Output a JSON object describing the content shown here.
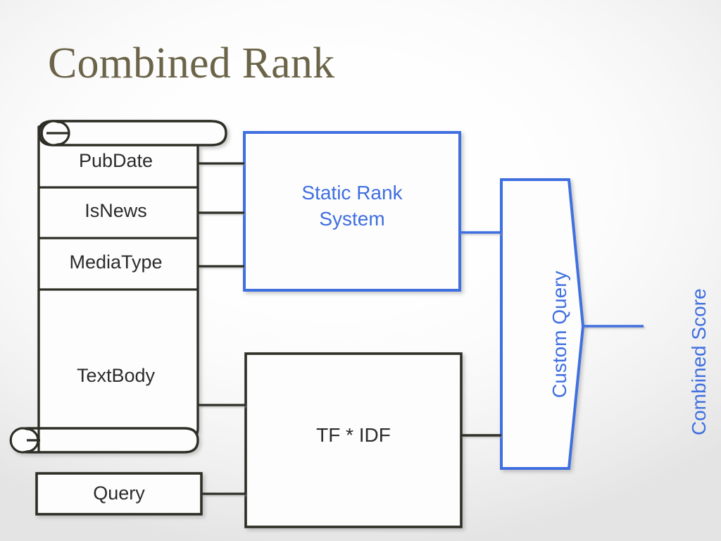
{
  "slide": {
    "title": "Combined Rank",
    "title_color": "#6b6449",
    "background": "#f2f2f2",
    "accent_blue": "#3f6fe0",
    "dark_stroke": "#2e2e27"
  },
  "document_scroll": {
    "name": "document-scroll",
    "rows": [
      {
        "label": "PubDate"
      },
      {
        "label": "IsNews"
      },
      {
        "label": "MediaType"
      },
      {
        "label": "TextBody"
      }
    ]
  },
  "query_box": {
    "label": "Query",
    "border_color": "#2e2e27",
    "text_color": "#2b2b2b"
  },
  "static_rank_box": {
    "label": "Static Rank\nSystem",
    "line1": "Static Rank",
    "line2": "System",
    "border_color": "#3f6fe0",
    "text_color": "#3f6fe0"
  },
  "tfidf_box": {
    "label": "TF * IDF",
    "border_color": "#2e2e27",
    "text_color": "#2b2b2b"
  },
  "custom_query_shape": {
    "label": "Custom Query",
    "border_color": "#3f6fe0",
    "text_color": "#3f6fe0",
    "orientation": "vertical"
  },
  "output_label": {
    "label": "Combined Score",
    "text_color": "#3f6fe0",
    "orientation": "vertical"
  },
  "connectors": [
    {
      "name": "pubdate-to-static-rank",
      "color": "#2e2e27"
    },
    {
      "name": "isnews-to-static-rank",
      "color": "#2e2e27"
    },
    {
      "name": "mediatype-to-static-rank",
      "color": "#2e2e27"
    },
    {
      "name": "textbody-to-tfidf",
      "color": "#2e2e27"
    },
    {
      "name": "query-to-tfidf",
      "color": "#2e2e27"
    },
    {
      "name": "static-rank-to-custom-query",
      "color": "#3f6fe0"
    },
    {
      "name": "tfidf-to-custom-query",
      "color": "#2e2e27"
    },
    {
      "name": "custom-query-to-combined-score",
      "color": "#3f6fe0"
    }
  ]
}
